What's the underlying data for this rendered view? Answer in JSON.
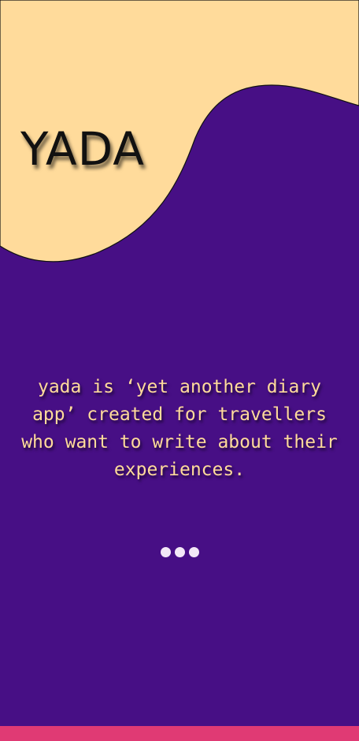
{
  "app": {
    "logo_text": "YADA",
    "tagline": "yada is ‘yet another diary app’ created for travellers who want to write about their experiences.",
    "pager": {
      "total_pages": 3
    }
  },
  "colors": {
    "background": "#470f85",
    "accent_cream": "#ffdb9b",
    "logo_text": "#111111",
    "dot": "#f3e8f7",
    "bottom_bar": "#e03a74"
  }
}
